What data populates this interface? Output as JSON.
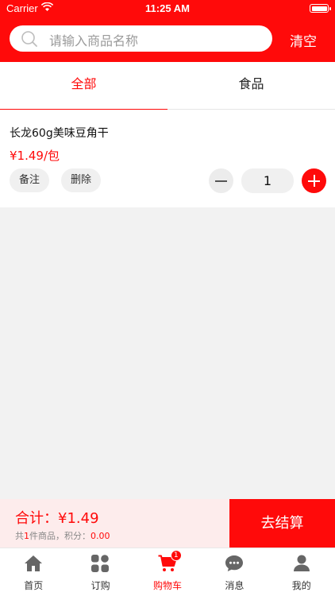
{
  "status_bar": {
    "carrier": "Carrier",
    "time": "11:25 AM"
  },
  "search": {
    "placeholder": "请输入商品名称",
    "clear_label": "清空"
  },
  "tabs": [
    {
      "label": "全部",
      "active": true
    },
    {
      "label": "食品",
      "active": false
    }
  ],
  "cart_item": {
    "name": "长龙60g美味豆角干",
    "price": "¥1.49/包",
    "note_label": "备注",
    "delete_label": "删除",
    "quantity": "1"
  },
  "checkout": {
    "total": "合计：¥1.49",
    "summary_prefix": "共",
    "summary_count": "1",
    "summary_middle": "件商品，积分：",
    "summary_points": "0.00",
    "button_label": "去结算"
  },
  "tab_bar": {
    "items": [
      {
        "label": "首页",
        "icon": "home-icon"
      },
      {
        "label": "订购",
        "icon": "grid-icon"
      },
      {
        "label": "购物车",
        "icon": "cart-icon",
        "badge": "1",
        "active": true
      },
      {
        "label": "消息",
        "icon": "chat-icon"
      },
      {
        "label": "我的",
        "icon": "user-icon"
      }
    ]
  },
  "colors": {
    "accent": "#ff0a0a",
    "background": "#f2f2f2",
    "checkout_bar": "#fdecec"
  }
}
